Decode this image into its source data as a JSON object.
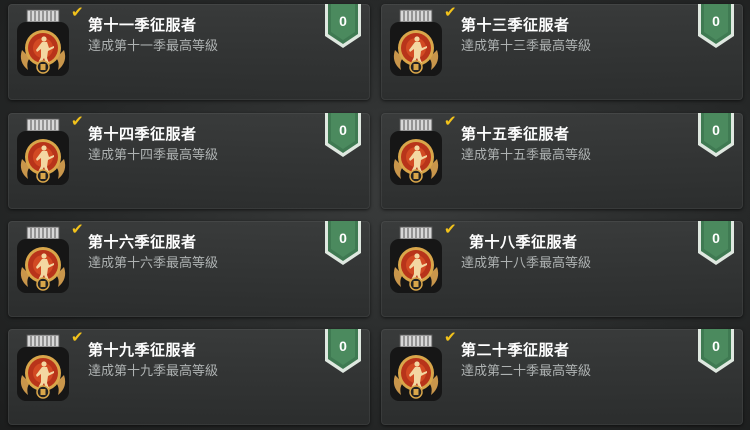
{
  "achievements": [
    {
      "title": "第十一季征服者",
      "description": "達成第十一季最高等級",
      "points": "0",
      "season_numeral": "11"
    },
    {
      "title": "第十三季征服者",
      "description": "達成第十三季最高等級",
      "points": "0",
      "season_numeral": "13"
    },
    {
      "title": "第十四季征服者",
      "description": "達成第十四季最高等級",
      "points": "0",
      "season_numeral": "14"
    },
    {
      "title": "第十五季征服者",
      "description": "達成第十五季最高等級",
      "points": "0",
      "season_numeral": "15"
    },
    {
      "title": "第十六季征服者",
      "description": "達成第十六季最高等級",
      "points": "0",
      "season_numeral": "16"
    },
    {
      "title": "第十八季征服者",
      "description": "達成第十八季最高等級",
      "points": "0",
      "season_numeral": "18"
    },
    {
      "title": "第十九季征服者",
      "description": "達成第十九季最高等級",
      "points": "0",
      "season_numeral": "19"
    },
    {
      "title": "第二十季征服者",
      "description": "達成第二十季最高等級",
      "points": "0",
      "season_numeral": "20"
    }
  ],
  "icons": {
    "badge": "conqueror-medal-icon",
    "check": "checkmark-icon",
    "points": "points-shield-icon"
  },
  "colors": {
    "check": "#f2c21b",
    "points_shield": "#3f7a52",
    "medal_red": "#c0391b",
    "medal_gold": "#d9a64a"
  }
}
